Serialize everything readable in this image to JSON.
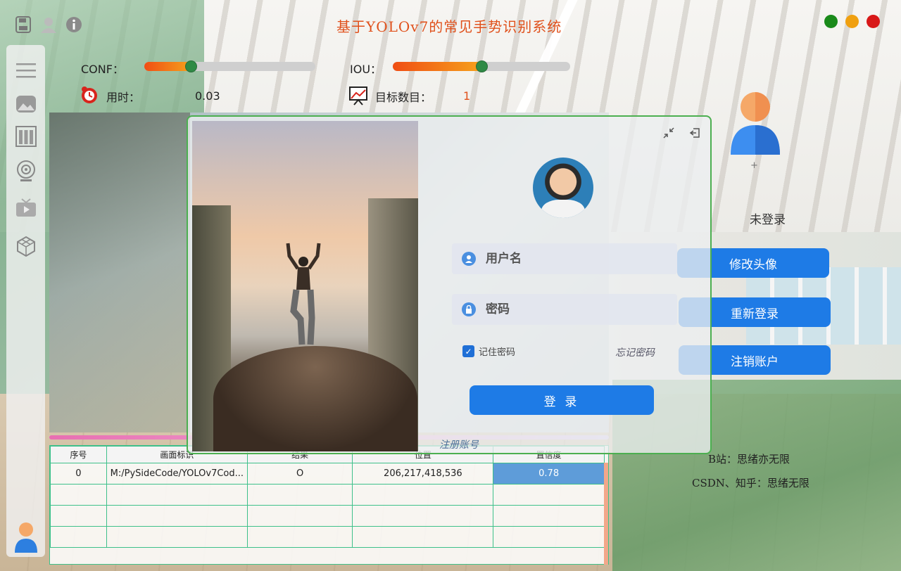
{
  "app": {
    "title": "基于YOLOv7的常见手势识别系统",
    "window_controls": [
      "#1a8a1a",
      "#f0a010",
      "#d81818"
    ]
  },
  "toolbar": {
    "icons": [
      "save-icon",
      "user-icon",
      "info-icon"
    ]
  },
  "sidebar": {
    "items": [
      "menu-icon",
      "image-icon",
      "folder-icon",
      "camera-icon",
      "video-icon",
      "model-icon"
    ],
    "bottom": "user-avatar-icon"
  },
  "params": {
    "conf_label": "CONF：",
    "conf_value": 0.27,
    "iou_label": "IOU：",
    "iou_value": 0.5,
    "time_label": "用时：",
    "time_value": "0.03",
    "count_label": "目标数目：",
    "count_value": "1"
  },
  "table": {
    "headers": [
      "序号",
      "画面标识",
      "结果",
      "位置",
      "置信度"
    ],
    "rows": [
      [
        "0",
        "M:/PySideCode/YOLOv7Cod...",
        "O",
        "206,217,418,536",
        "0.78"
      ]
    ]
  },
  "right_panel": {
    "plus": "+",
    "status": "未登录",
    "buttons": [
      "修改头像",
      "重新登录",
      "注销账户"
    ],
    "credit1": "B站：思绪亦无限",
    "credit2": "CSDN、知乎：思绪无限"
  },
  "dialog": {
    "username_placeholder": "用户名",
    "password_placeholder": "密码",
    "remember_label": "记住密码",
    "remember_checked": true,
    "forgot_label": "忘记密码",
    "login_label": "登 录",
    "register_label": "注册账号"
  },
  "colors": {
    "accent": "#1e7be6",
    "title": "#e0511c",
    "border": "#4caf50"
  }
}
